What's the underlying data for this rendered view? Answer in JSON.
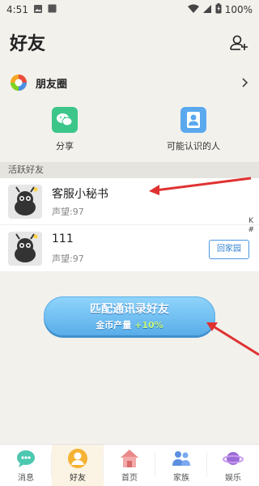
{
  "status_bar": {
    "time": "4:51",
    "battery": "100%"
  },
  "header": {
    "title": "好友"
  },
  "moments": {
    "label": "朋友圈"
  },
  "actions": [
    {
      "label": "分享"
    },
    {
      "label": "可能认识的人"
    }
  ],
  "section": {
    "active_friends_label": "活跃好友"
  },
  "friends": [
    {
      "name": "客服小秘书",
      "reputation": "声望:97"
    },
    {
      "name": "111",
      "reputation": "声望:97",
      "button_label": "回家园"
    }
  ],
  "index_letters": [
    "K",
    "#"
  ],
  "match_button": {
    "title": "匹配通讯录好友",
    "subtitle": "金币产量",
    "bonus": "+10%"
  },
  "tabs": [
    {
      "label": "消息"
    },
    {
      "label": "好友"
    },
    {
      "label": "首页"
    },
    {
      "label": "家族"
    },
    {
      "label": "娱乐"
    }
  ],
  "colors": {
    "accent_blue": "#5aaeea",
    "wechat_green": "#3cc68a",
    "arrow_red": "#e03131"
  }
}
